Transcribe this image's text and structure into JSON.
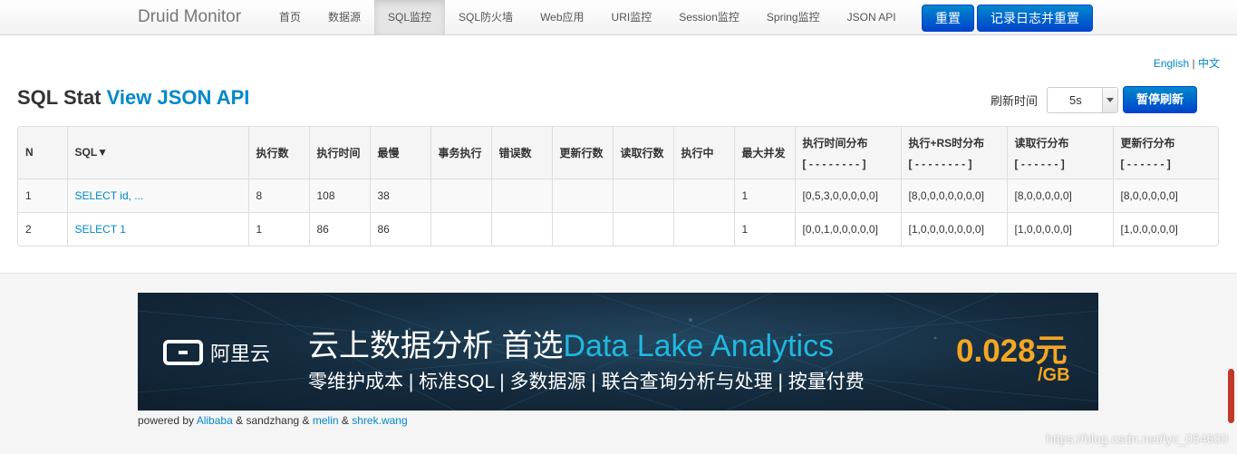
{
  "nav": {
    "brand": "Druid Monitor",
    "items": [
      "首页",
      "数据源",
      "SQL监控",
      "SQL防火墙",
      "Web应用",
      "URI监控",
      "Session监控",
      "Spring监控",
      "JSON API"
    ],
    "active_index": 2,
    "reset_label": "重置",
    "log_reset_label": "记录日志并重置"
  },
  "lang": {
    "english": "English",
    "sep": "|",
    "chinese": "中文"
  },
  "page": {
    "title": "SQL Stat",
    "json_link": "View JSON API"
  },
  "refresh": {
    "label": "刷新时间",
    "value": "5s",
    "pause_label": "暂停刷新"
  },
  "table": {
    "headers": [
      {
        "main": "N",
        "sub": ""
      },
      {
        "main": "SQL▼",
        "sub": ""
      },
      {
        "main": "执行数",
        "sub": ""
      },
      {
        "main": "执行时间",
        "sub": ""
      },
      {
        "main": "最慢",
        "sub": ""
      },
      {
        "main": "事务执行",
        "sub": ""
      },
      {
        "main": "错误数",
        "sub": ""
      },
      {
        "main": "更新行数",
        "sub": ""
      },
      {
        "main": "读取行数",
        "sub": ""
      },
      {
        "main": "执行中",
        "sub": ""
      },
      {
        "main": "最大并发",
        "sub": ""
      },
      {
        "main": "执行时间分布",
        "sub": "[ - - - - - - - - ]"
      },
      {
        "main": "执行+RS时分布",
        "sub": "[ - - - - - - - - ]"
      },
      {
        "main": "读取行分布",
        "sub": "[ - - - - - - ]"
      },
      {
        "main": "更新行分布",
        "sub": "[ - - - - - - ]"
      }
    ],
    "rows": [
      [
        "1",
        "SELECT id, ...",
        "8",
        "108",
        "38",
        "",
        "",
        "",
        "",
        "",
        "1",
        "[0,5,3,0,0,0,0,0]",
        "[8,0,0,0,0,0,0,0]",
        "[8,0,0,0,0,0]",
        "[8,0,0,0,0,0]"
      ],
      [
        "2",
        "SELECT 1",
        "1",
        "86",
        "86",
        "",
        "",
        "",
        "",
        "",
        "1",
        "[0,0,1,0,0,0,0,0]",
        "[1,0,0,0,0,0,0,0]",
        "[1,0,0,0,0,0]",
        "[1,0,0,0,0,0]"
      ]
    ]
  },
  "banner": {
    "logo_text": "阿里云",
    "headline_prefix": "云上数据分析 首选",
    "headline_highlight": "Data Lake Analytics",
    "subline": "零维护成本 | 标准SQL | 多数据源 | 联合查询分析与处理 | 按量付费",
    "price": "0.028元",
    "price_unit": "/GB"
  },
  "footer": {
    "powered_by": "powered by",
    "alibaba": "Alibaba",
    "amp1": "&",
    "sandzhang": "sandzhang",
    "amp2": "&",
    "melin": "melin",
    "amp3": "&",
    "shrek": "shrek.wang",
    "watermark": "https://blog.csdn.net/lyc_054600"
  }
}
